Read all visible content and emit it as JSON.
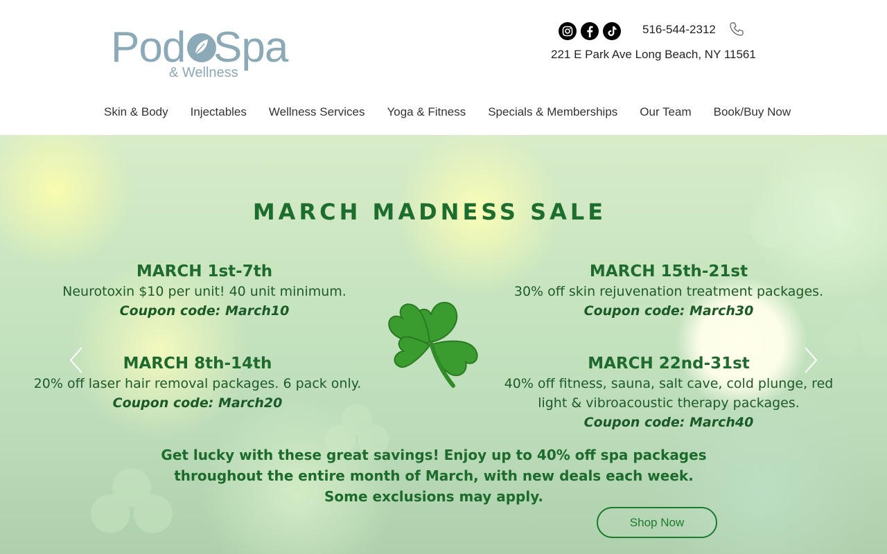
{
  "header": {
    "logo": {
      "word1": "Pod",
      "word2": "Spa",
      "sub": "& Wellness"
    },
    "socials": [
      {
        "name": "instagram-icon"
      },
      {
        "name": "facebook-icon"
      },
      {
        "name": "tiktok-icon"
      }
    ],
    "phone": "516-544-2312",
    "address": "221 E Park Ave Long Beach, NY 11561"
  },
  "nav": {
    "items": [
      {
        "label": "Skin & Body"
      },
      {
        "label": "Injectables"
      },
      {
        "label": "Wellness Services"
      },
      {
        "label": "Yoga & Fitness"
      },
      {
        "label": "Specials & Memberships"
      },
      {
        "label": "Our Team"
      },
      {
        "label": "Book/Buy Now"
      }
    ]
  },
  "hero": {
    "title": "MARCH MADNESS SALE",
    "deals": [
      {
        "date": "MARCH 1st-7th",
        "desc": "Neurotoxin $10 per unit! 40 unit minimum.",
        "code": "Coupon code: March10"
      },
      {
        "date": "MARCH 8th-14th",
        "desc": "20% off laser hair removal packages. 6 pack only.",
        "code": "Coupon code: March20"
      },
      {
        "date": "MARCH 15th-21st",
        "desc": "30% off skin rejuvenation treatment packages.",
        "code": "Coupon code: March30"
      },
      {
        "date": "MARCH 22nd-31st",
        "desc": "40% off fitness, sauna, salt cave, cold plunge, red light & vibroacoustic therapy packages.",
        "code": "Coupon code: March40"
      }
    ],
    "summary_line1": "Get lucky with these great savings! Enjoy up to 40% off spa packages",
    "summary_line2": "throughout the entire month of March, with new deals each week.",
    "summary_line3": "Some exclusions may apply.",
    "shop_button": "Shop Now"
  },
  "colors": {
    "brand_logo": "#8ba9b6",
    "hero_green": "#1d6e2e",
    "shamrock": "#3a9b2e"
  }
}
